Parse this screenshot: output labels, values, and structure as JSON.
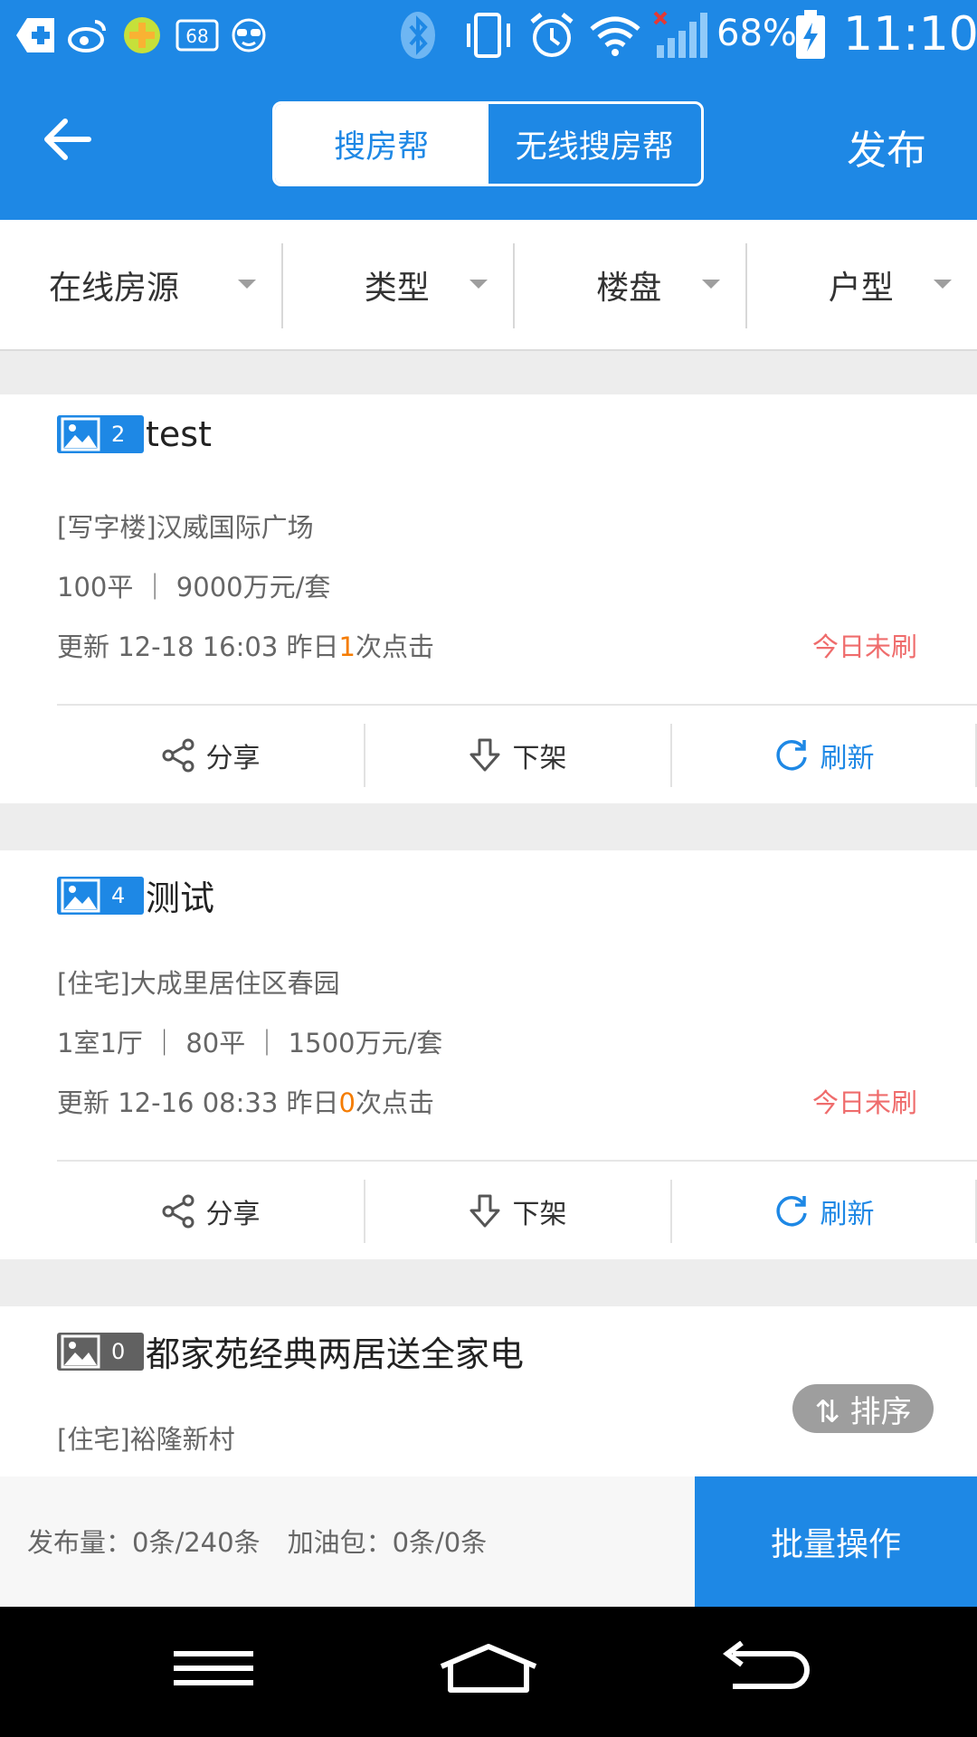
{
  "status_bar": {
    "battery_percent": "68%",
    "time": "11:10",
    "notification_badge": "68",
    "icons": [
      "health-cross-icon",
      "weibo-icon",
      "plus-coin-icon",
      "counter-badge-icon",
      "glasses-face-icon",
      "bluetooth-icon",
      "vibrate-icon",
      "alarm-icon",
      "wifi-icon",
      "signal-no-sim-icon",
      "battery-charging-icon"
    ]
  },
  "header": {
    "tabs": [
      {
        "label": "搜房帮",
        "active": true
      },
      {
        "label": "无线搜房帮",
        "active": false
      }
    ],
    "publish_label": "发布"
  },
  "filters": [
    {
      "label": "在线房源"
    },
    {
      "label": "类型"
    },
    {
      "label": "楼盘"
    },
    {
      "label": "户型"
    }
  ],
  "listings": [
    {
      "photo_count": "2",
      "title": "test",
      "category_location": "[写字楼]汉威国际广场",
      "specs": "100平 ｜ 9000万元/套",
      "update_prefix": "更新 12-18 16:03  昨日",
      "clicks": "1",
      "update_suffix": "次点击",
      "refresh_status": "今日未刷"
    },
    {
      "photo_count": "4",
      "title": "测试",
      "category_location": "[住宅]大成里居住区春园",
      "specs": "1室1厅 ｜ 80平 ｜ 1500万元/套",
      "update_prefix": "更新 12-16 08:33  昨日",
      "clicks": "0",
      "update_suffix": "次点击",
      "refresh_status": "今日未刷"
    },
    {
      "photo_count": "0",
      "title": "都家苑经典两居送全家电",
      "category_location": "[住宅]裕隆新村"
    }
  ],
  "actions": {
    "share": "分享",
    "unlist": "下架",
    "refresh": "刷新"
  },
  "sort_label": "⇅ 排序",
  "footer": {
    "publish_quota": "发布量：0条/240条",
    "boost_pack": "加油包：0条/0条",
    "batch_label": "批量操作"
  },
  "colors": {
    "brand_blue": "#1e88e5",
    "highlight_orange": "#f57c00",
    "alert_red": "#ef6c6c"
  }
}
